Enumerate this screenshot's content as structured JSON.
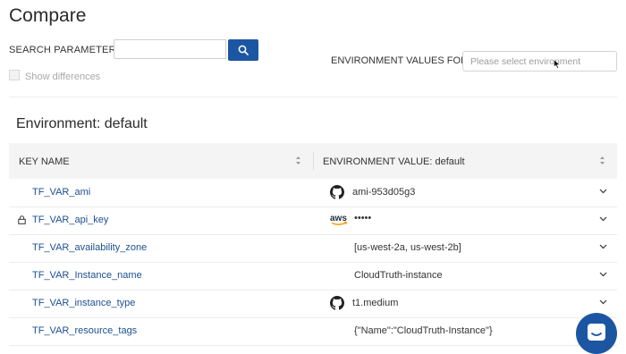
{
  "page": {
    "title": "Compare"
  },
  "search": {
    "label": "SEARCH PARAMETERS",
    "colon": ":",
    "value": "",
    "button_icon": "search-icon"
  },
  "show_differences": {
    "label": "Show differences",
    "checked": false
  },
  "environment_selector": {
    "label": "ENVIRONMENT VALUES FOR:",
    "placeholder": "Please select environment"
  },
  "environment": {
    "heading": "Environment: default"
  },
  "table": {
    "columns": [
      "KEY NAME",
      "ENVIRONMENT VALUE: default"
    ],
    "rows": [
      {
        "key": "TF_VAR_ami",
        "source_icon": "github-icon",
        "value": "ami-953d05g3",
        "locked": false
      },
      {
        "key": "TF_VAR_api_key",
        "source_icon": "aws-icon",
        "value": "•••••",
        "locked": true
      },
      {
        "key": "TF_VAR_availability_zone",
        "source_icon": "",
        "value": "[us-west-2a, us-west-2b]",
        "locked": false
      },
      {
        "key": "TF_VAR_Instance_name",
        "source_icon": "",
        "value": "CloudTruth-instance",
        "locked": false
      },
      {
        "key": "TF_VAR_instance_type",
        "source_icon": "github-icon",
        "value": "t1.medium",
        "locked": false
      },
      {
        "key": "TF_VAR_resource_tags",
        "source_icon": "",
        "value": "{\"Name\":\"CloudTruth-Instance\"}",
        "locked": false
      }
    ]
  },
  "aws_icon_text": "aws",
  "colors": {
    "accent": "#1c56a3",
    "link": "#1d4f91",
    "header_bg": "#f4f4f4"
  }
}
